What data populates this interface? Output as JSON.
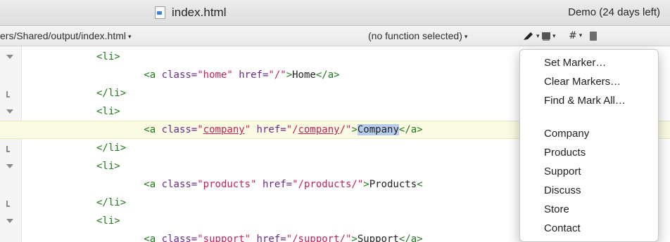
{
  "window": {
    "title": "index.html",
    "demo_status": "Demo (24 days left)"
  },
  "navbar": {
    "path": "ers/Shared/output/index.html",
    "function_popup": "(no function selected)",
    "marker_icon": "marker-pen-icon",
    "bookmark_icon": "bookmarks-icon",
    "hash_label": "#",
    "document_icon": "document-icon"
  },
  "editor": {
    "lines": [
      {
        "fold": "open",
        "indent": "",
        "parts": [
          [
            "tag",
            "<li>"
          ]
        ]
      },
      {
        "fold": "",
        "indent": "        ",
        "parts": [
          [
            "tag",
            "<a "
          ],
          [
            "attr",
            "class="
          ],
          [
            "val",
            "\"home\""
          ],
          [
            "attr",
            " href="
          ],
          [
            "val",
            "\"/\""
          ],
          [
            "tag",
            ">"
          ],
          [
            "txt",
            "Home"
          ],
          [
            "tag",
            "</a>"
          ]
        ]
      },
      {
        "fold": "end",
        "indent": "",
        "parts": [
          [
            "tag",
            "</li>"
          ]
        ]
      },
      {
        "fold": "open",
        "indent": "",
        "parts": [
          [
            "tag",
            "<li>"
          ]
        ]
      },
      {
        "fold": "",
        "indent": "        ",
        "parts": [
          [
            "tag",
            "<a "
          ],
          [
            "attr",
            "class="
          ],
          [
            "val",
            "\""
          ],
          [
            "valu",
            "company"
          ],
          [
            "val",
            "\""
          ],
          [
            "attr",
            " href="
          ],
          [
            "val",
            "\"/"
          ],
          [
            "valu",
            "company"
          ],
          [
            "val",
            "/\""
          ],
          [
            "tag",
            ">"
          ],
          [
            "sel",
            "Company"
          ],
          [
            "tag",
            "</a>"
          ]
        ]
      },
      {
        "fold": "end",
        "indent": "",
        "parts": [
          [
            "tag",
            "</li>"
          ]
        ]
      },
      {
        "fold": "open",
        "indent": "",
        "parts": [
          [
            "tag",
            "<li>"
          ]
        ]
      },
      {
        "fold": "",
        "indent": "        ",
        "parts": [
          [
            "tag",
            "<a "
          ],
          [
            "attr",
            "class="
          ],
          [
            "val",
            "\"products\""
          ],
          [
            "attr",
            " href="
          ],
          [
            "val",
            "\"/products/\""
          ],
          [
            "tag",
            ">"
          ],
          [
            "txt",
            "Products"
          ],
          [
            "tag",
            "<"
          ]
        ]
      },
      {
        "fold": "end",
        "indent": "",
        "parts": [
          [
            "tag",
            "</li>"
          ]
        ]
      },
      {
        "fold": "open",
        "indent": "",
        "parts": [
          [
            "tag",
            "<li>"
          ]
        ]
      },
      {
        "fold": "",
        "indent": "        ",
        "parts": [
          [
            "tag",
            "<a "
          ],
          [
            "attr",
            "class="
          ],
          [
            "val",
            "\"support\""
          ],
          [
            "attr",
            " href="
          ],
          [
            "val",
            "\"/support/\""
          ],
          [
            "tag",
            ">"
          ],
          [
            "txt",
            "Support"
          ],
          [
            "tag",
            "</a>"
          ]
        ]
      }
    ]
  },
  "marker_menu": {
    "actions": [
      "Set Marker…",
      "Clear Markers…",
      "Find & Mark All…"
    ],
    "markers": [
      "Company",
      "Products",
      "Support",
      "Discuss",
      "Store",
      "Contact"
    ]
  }
}
